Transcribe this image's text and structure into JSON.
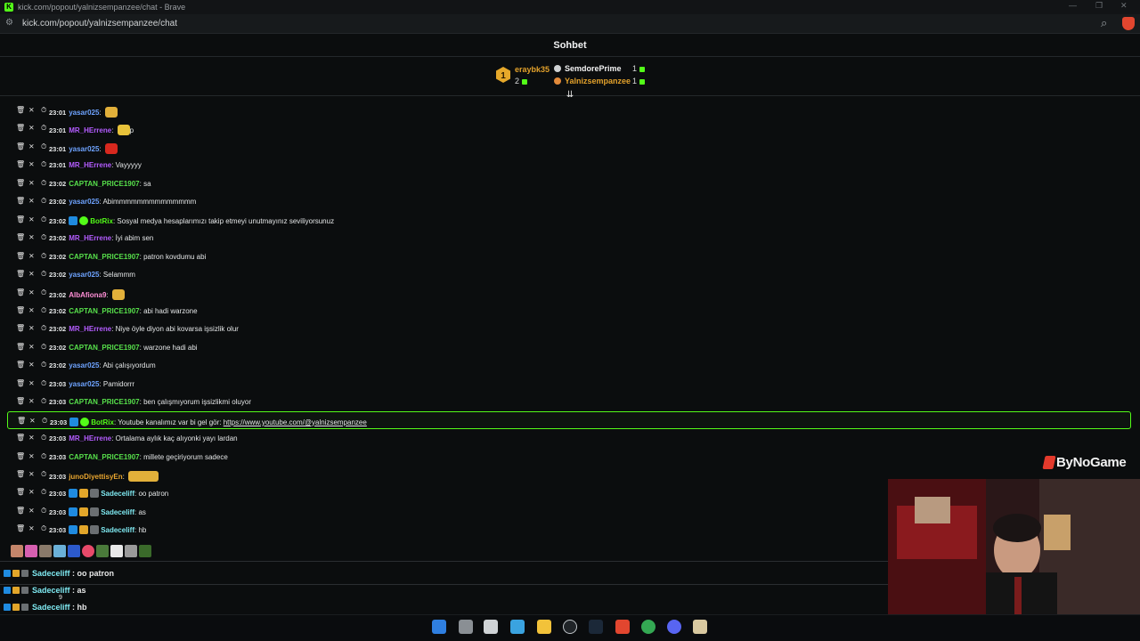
{
  "browser": {
    "window_title": "kick.com/popout/yalnizsempanzee/chat - Brave",
    "url": "kick.com/popout/yalnizsempanzee/chat"
  },
  "chat": {
    "header_title": "Sohbet",
    "leaderboard": [
      {
        "name": "eraybk35",
        "count": "2",
        "color": "#e3a12b"
      },
      {
        "name": "SemdorePrime",
        "count": "1",
        "color": "#f2f2f2"
      },
      {
        "name": "Yalnizsempanzee",
        "count": "1",
        "color": "#e3a12b"
      }
    ],
    "messages": [
      {
        "time": "23:01",
        "user": "yasar025",
        "color": "#6ea3ff",
        "text": "",
        "badges": [],
        "emote": true,
        "highlight": false
      },
      {
        "time": "23:01",
        "user": "MR_HErrene",
        "color": "#b45cff",
        "text": "p",
        "badges": [],
        "emote": true,
        "highlight": false
      },
      {
        "time": "23:01",
        "user": "yasar025",
        "color": "#6ea3ff",
        "text": "",
        "badges": [],
        "emote": true,
        "highlight": false
      },
      {
        "time": "23:01",
        "user": "MR_HErrene",
        "color": "#b45cff",
        "text": "Vayyyyy",
        "badges": [],
        "emote": false,
        "highlight": false
      },
      {
        "time": "23:02",
        "user": "CAPTAN_PRICE1907",
        "color": "#57e04b",
        "text": "sa",
        "badges": [],
        "emote": false,
        "highlight": false
      },
      {
        "time": "23:02",
        "user": "yasar025",
        "color": "#6ea3ff",
        "text": "Abimmmmmmmmmmmmmm",
        "badges": [],
        "emote": false,
        "highlight": false
      },
      {
        "time": "23:02",
        "user": "BotRix",
        "color": "#53fc18",
        "text": "Sosyal medya hesaplarımızı takip etmeyi unutmayınız seviliyorsunuz",
        "badges": [
          "blue",
          "verified"
        ],
        "emote": false,
        "highlight": false
      },
      {
        "time": "23:02",
        "user": "MR_HErrene",
        "color": "#b45cff",
        "text": "İyi abim sen",
        "badges": [],
        "emote": false,
        "highlight": false
      },
      {
        "time": "23:02",
        "user": "CAPTAN_PRICE1907",
        "color": "#57e04b",
        "text": "patron kovdumu abi",
        "badges": [],
        "emote": false,
        "highlight": false
      },
      {
        "time": "23:02",
        "user": "yasar025",
        "color": "#6ea3ff",
        "text": "Selammm",
        "badges": [],
        "emote": false,
        "highlight": false
      },
      {
        "time": "23:02",
        "user": "AlbAfiona9",
        "color": "#ff8fd6",
        "text": "",
        "badges": [],
        "emote": true,
        "highlight": false
      },
      {
        "time": "23:02",
        "user": "CAPTAN_PRICE1907",
        "color": "#57e04b",
        "text": "abi hadi warzone",
        "badges": [],
        "emote": false,
        "highlight": false
      },
      {
        "time": "23:02",
        "user": "MR_HErrene",
        "color": "#b45cff",
        "text": "Niye öyle diyon abi kovarsa işsizlik olur",
        "badges": [],
        "emote": false,
        "highlight": false
      },
      {
        "time": "23:02",
        "user": "CAPTAN_PRICE1907",
        "color": "#57e04b",
        "text": "warzone hadi abi",
        "badges": [],
        "emote": false,
        "highlight": false
      },
      {
        "time": "23:02",
        "user": "yasar025",
        "color": "#6ea3ff",
        "text": "Abi çalışıyordum",
        "badges": [],
        "emote": false,
        "highlight": false
      },
      {
        "time": "23:03",
        "user": "yasar025",
        "color": "#6ea3ff",
        "text": "Pamidorrr",
        "badges": [],
        "emote": false,
        "highlight": false
      },
      {
        "time": "23:03",
        "user": "CAPTAN_PRICE1907",
        "color": "#57e04b",
        "text": "ben çalışmıyorum işsizlikmi oluyor",
        "badges": [],
        "emote": false,
        "highlight": false
      },
      {
        "time": "23:03",
        "user": "BotRix",
        "color": "#53fc18",
        "text": "Youtube kanalımız var bi gel gör: ",
        "link": "https://www.youtube.com/@yalnizsempanzee",
        "badges": [
          "blue",
          "verified"
        ],
        "emote": false,
        "highlight": true
      },
      {
        "time": "23:03",
        "user": "MR_HErrene",
        "color": "#b45cff",
        "text": "Ortalama aylık kaç alıyonki yayı lardan",
        "badges": [],
        "emote": false,
        "highlight": false
      },
      {
        "time": "23:03",
        "user": "CAPTAN_PRICE1907",
        "color": "#57e04b",
        "text": "millete geçiriyorum sadece",
        "badges": [],
        "emote": false,
        "highlight": false
      },
      {
        "time": "23:03",
        "user": "junoDiyettisyEn",
        "color": "#e8a52f",
        "text": "",
        "badges": [],
        "emote": "wide",
        "highlight": false
      },
      {
        "time": "23:03",
        "user": "Sadeceliff",
        "color": "#7ee8f0",
        "text": "oo patron",
        "badges": [
          "blue",
          "crown",
          "sub"
        ],
        "emote": false,
        "highlight": false
      },
      {
        "time": "23:03",
        "user": "Sadeceliff",
        "color": "#7ee8f0",
        "text": "as",
        "badges": [
          "blue",
          "crown",
          "sub"
        ],
        "emote": false,
        "highlight": false
      },
      {
        "time": "23:03",
        "user": "Sadeceliff",
        "color": "#7ee8f0",
        "text": "hb",
        "badges": [
          "blue",
          "crown",
          "sub"
        ],
        "emote": false,
        "highlight": false
      }
    ]
  },
  "overlay_messages": [
    {
      "user": "Sadeceliff",
      "text": "oo patron"
    },
    {
      "user": "Sadeceliff",
      "text": "as"
    },
    {
      "user": "Sadeceliff",
      "text": "hb"
    }
  ],
  "overlay_counter": "9",
  "brand": {
    "name": "ByNoGame"
  },
  "colors": {
    "accent": "#53fc18",
    "background": "#0b0d0e"
  }
}
